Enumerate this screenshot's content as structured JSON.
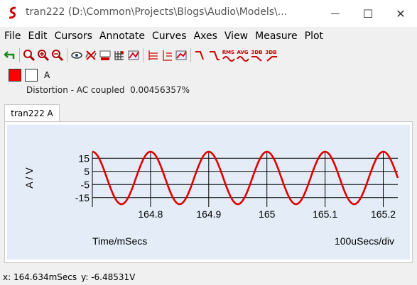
{
  "window": {
    "title": "tran222 (D:\\Common\\Projects\\Blogs\\Audio\\Models\\...",
    "minimize_glyph": "—",
    "maximize_glyph": "☐",
    "close_glyph": "✕"
  },
  "menu": [
    "File",
    "Edit",
    "Cursors",
    "Annotate",
    "Curves",
    "Axes",
    "View",
    "Measure",
    "Plot"
  ],
  "toolbar": {
    "rms_label": "RMS",
    "avg_label": "AVG",
    "db3_label": "3DB",
    "db3b_label": "3DB"
  },
  "legend": {
    "curve_label": "A",
    "curve_color": "#ff0000",
    "blank_color": "#ffffff"
  },
  "measurement": {
    "text": "Distortion - AC coupled  0.00456357%"
  },
  "tab": {
    "label": "tran222 A"
  },
  "status": {
    "x_readout": "x: 164.634mSecs",
    "y_readout": "y: -6.48531V"
  },
  "chart_data": {
    "type": "line",
    "xlabel": "Time/mSecs",
    "ylabel": "A / V",
    "x_scale_label": "100uSecs/div",
    "xlim": [
      164.7,
      165.225
    ],
    "ylim": [
      -20,
      20
    ],
    "x_ticks": [
      "164.8",
      "164.9",
      "165",
      "165.1",
      "165.2"
    ],
    "x_tick_values": [
      164.8,
      164.9,
      165.0,
      165.1,
      165.2
    ],
    "y_ticks": [
      "15",
      "5",
      "-5",
      "-15"
    ],
    "y_tick_values": [
      15,
      5,
      -5,
      -15
    ],
    "grid": true,
    "series": [
      {
        "amplitude": 20,
        "frequency_hz": 10000,
        "first_peak_ms": 164.7,
        "color": "#e00000"
      }
    ]
  }
}
